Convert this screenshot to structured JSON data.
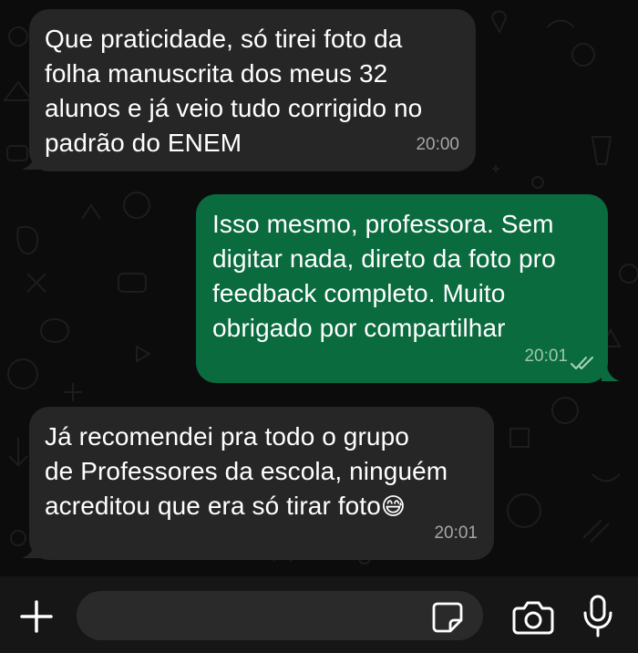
{
  "messages": [
    {
      "direction": "incoming",
      "text": "Que praticidade, só tirei foto da\nfolha manuscrita dos meus 32\nalunos e já veio tudo corrigido no\npadrão do ENEM",
      "time": "20:00"
    },
    {
      "direction": "outgoing",
      "text": "Isso mesmo, professora. Sem\ndigitar nada, direto da foto pro\nfeedback completo. Muito\nobrigado por compartilhar",
      "time": "20:01",
      "status": "read"
    },
    {
      "direction": "incoming",
      "text": "Já recomendei pra todo o grupo\nde Professores da escola, ninguém\nacreditou que era só tirar foto",
      "emoji": "😅",
      "time": "20:01"
    }
  ],
  "composer": {
    "value": "",
    "icons": {
      "attach": "plus-icon",
      "sticker": "sticker-icon",
      "camera": "camera-icon",
      "mic": "microphone-icon"
    }
  },
  "colors": {
    "background": "#0c0c0c",
    "incoming_bubble": "#262626",
    "outgoing_bubble": "#0a6b3e",
    "composer_bar": "#161616",
    "composer_input": "#2a2a2a",
    "icon": "#ffffff"
  }
}
